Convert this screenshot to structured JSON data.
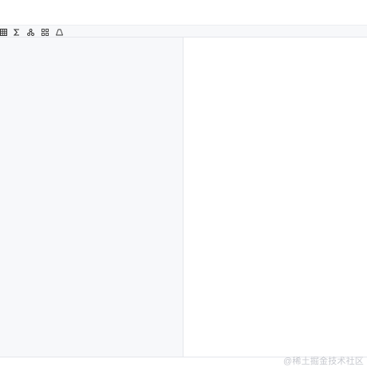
{
  "toolbar": {
    "buttons": [
      {
        "icon": "table-icon"
      },
      {
        "icon": "sigma-icon"
      },
      {
        "icon": "diagram-icon"
      },
      {
        "icon": "grid-icon"
      },
      {
        "icon": "erase-icon"
      }
    ]
  },
  "footer": {
    "watermark": "@稀土掘金技术社区"
  },
  "colors": {
    "toolbar_bg": "#f7f8fa",
    "editor_bg": "#f7f8fa",
    "preview_bg": "#ffffff",
    "border": "#e4e6eb",
    "icon": "#333333",
    "watermark": "#c7c9cf"
  }
}
